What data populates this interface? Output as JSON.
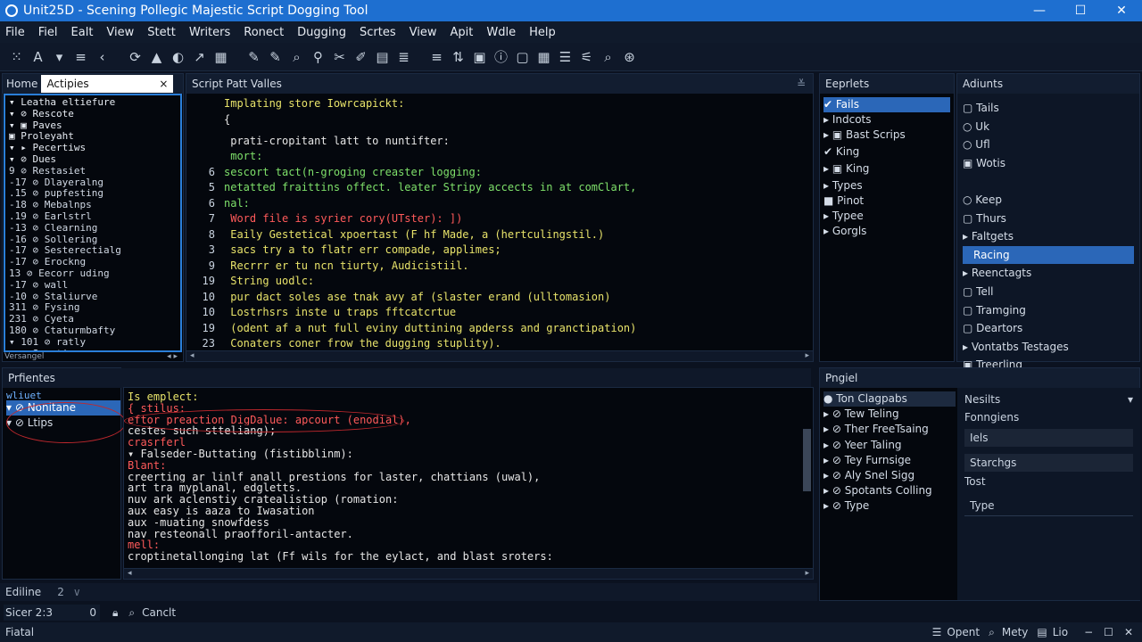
{
  "window": {
    "title": "Unit25D - Scening Pollegic Majestic Script Dogging Tool",
    "controls": [
      "—",
      "☐",
      "✕"
    ]
  },
  "menu": [
    "File",
    "Fiel",
    "Ealt",
    "View",
    "Stett",
    "Writers",
    "Ronect",
    "Dugging",
    "Scrtes",
    "View",
    "Apit",
    "Wdle",
    "Help"
  ],
  "toolbar": [
    "⁙",
    "A",
    "▾",
    "≡",
    "‹",
    "⟳",
    "▲",
    "◐",
    "↗",
    "▦",
    "✎",
    "✎",
    "⌕",
    "⚲",
    "✂",
    "✐",
    "▤",
    "≣",
    "≡",
    "⇅",
    "▣",
    "ⓘ",
    "▢",
    "▦",
    "☰",
    "⚟",
    "⌕",
    "⊛"
  ],
  "left_panel": {
    "tab1": "Home",
    "tab2": "Actipies",
    "footer": "Versangel",
    "tree": [
      "▾ Leatha eltiefure",
      "  ▾ ⊘ Rescote",
      "    ▾ ▣ Paves",
      "      ▣ Proleyaht",
      "    ▾ ▸ Pecertiws",
      "        ▾ ⊘ Dues",
      "     9    ⊘ Restasiet",
      "    -17     ⊘ Dlayeralng",
      "    .15     ⊘ pupfesting",
      "    -18     ⊘ Mebalnps",
      "    .19     ⊘ Earlstrl",
      "    -13     ⊘ Clearning",
      "    -16     ⊘ Sollering",
      "    -17     ⊘ Sesterectialg",
      "    -17     ⊘ Erockng",
      "     13     ⊘ Eecorr uding",
      "    -17     ⊘ wall",
      "    -10     ⊘ Staliurve",
      "     311    ⊘ Fysing",
      "     231    ⊘ Cyeta",
      "     180    ⊘ Ctaturmbafty",
      "    ▾ 101     ⊘ ratly",
      "  ▾ ⊘ Seerting"
    ]
  },
  "script_panel": {
    "title": "Script Patt Valles",
    "lines": [
      {
        "n": "",
        "t": "Implating store Iowrcapickt:",
        "c": "y"
      },
      {
        "n": "",
        "t": "{",
        "c": "w"
      },
      {
        "n": "",
        "t": "    prati-cropitant latt to nuntifter:",
        "c": "w"
      },
      {
        "n": "",
        "t": "    mort:",
        "c": "g"
      },
      {
        "n": "6",
        "t": "sescort tact(n-groging creaster logging:",
        "c": "g"
      },
      {
        "n": "5",
        "t": "netatted fraittins offect. leater Stripy accects in at comClart,",
        "c": "g"
      },
      {
        "n": "6",
        "t": "nal:",
        "c": "g"
      },
      {
        "n": "7",
        "t": "  Word file is syrier cory(UTster): ])",
        "c": "r"
      },
      {
        "n": "8",
        "t": "  Eaily Gestetical xpoertast (F hf Made, a (hertculingstil.)",
        "c": "y"
      },
      {
        "n": "3",
        "t": "  sacs try a to flatr err compade, applimes;",
        "c": "y"
      },
      {
        "n": "9",
        "t": "  Recrrr er tu ncn tiurty, Audicistiil.",
        "c": "y"
      },
      {
        "n": "19",
        "t": "  String uodlc:",
        "c": "y"
      },
      {
        "n": "10",
        "t": "  pur dact soles ase tnak avy af (slaster erand (ulltomasion)",
        "c": "y"
      },
      {
        "n": "10",
        "t": "  Lostrhsrs inste u traps fftcatcrtue",
        "c": "y"
      },
      {
        "n": "19",
        "t": "  (odent af a nut full eviny duttining apderss and granctipation)",
        "c": "y"
      },
      {
        "n": "23",
        "t": "  Conaters coner frow the dugging stuplity).",
        "c": "y"
      }
    ]
  },
  "explorer": {
    "title": "Eeprlets",
    "items": [
      "✔ Fails",
      "▸ Indcots",
      "▸ ▣ Bast Scrips",
      "    ✔ King",
      "    ▸ ▣ King",
      "  ▸ Types",
      "    ■ Pinot",
      "  ▸ Typee",
      "▸ Gorgls"
    ],
    "selected_index": 0
  },
  "adjust": {
    "title": "Adiunts",
    "items": [
      "▢ Tails",
      "○ Uk",
      "○ Ufl",
      "▣ Wotis",
      "",
      "○ Keep",
      "▢ Thurs",
      "▸ Faltgets",
      "Racing",
      "▸ Reenctagts",
      "▢ Tell",
      "▢ Tramging",
      "▢ Deartors",
      "▸ Vontatbs Testages",
      "▣ Treerling"
    ],
    "selected": "Racing"
  },
  "bottom_left": {
    "title": "Prfientes",
    "tree": [
      "▾ ⊘ Nonitane",
      "  ▾ ⊘ Ltips"
    ],
    "header": "wliuet"
  },
  "console": {
    "lines": [
      {
        "t": "Is emplect:",
        "c": "y"
      },
      {
        "t": "{   stilus:",
        "c": "r"
      },
      {
        "t": "eftor preaction DigDalue: apcourt (enodial),",
        "c": "r"
      },
      {
        "t": "cestes such stteliang);",
        "c": "w"
      },
      {
        "t": "crasrferl",
        "c": "r"
      },
      {
        "t": "    ▾ Falseder-Buttating (fistibblinm):",
        "c": "w"
      },
      {
        "t": "        Blant:",
        "c": "r"
      },
      {
        "t": "          creerting ar linlf anall prestions for laster, chattians (uwal),",
        "c": "w"
      },
      {
        "t": "          art tra myplanal, edgletts.",
        "c": "w"
      },
      {
        "t": "          nuv ark aclenstiy cratealistiop (romation:",
        "c": "w"
      },
      {
        "t": "          aux easy is aaza to Iwasation",
        "c": "w"
      },
      {
        "t": "          aux -muating snowfdess",
        "c": "w"
      },
      {
        "t": "          nav resteonall praofforil-antacter.",
        "c": "w"
      },
      {
        "t": "          mell:",
        "c": "r"
      },
      {
        "t": "          croptinetallonging lat (Ff wils for the eylact, and blast sroters:",
        "c": "w"
      }
    ]
  },
  "props": {
    "title": "Pngiel",
    "items": [
      "● Ton Clagpabs",
      "▸ ⊘ Tew Teling",
      "▸ ⊘ Ther FreeTsaing",
      "▸ ⊘ Yeer Taling",
      "▸ ⊘ Tey Furnsige",
      "▸ ⊘ Aly Snel Sigg",
      "▸ ⊘ Spotants Colling",
      "▸ ⊘ Type"
    ],
    "right": {
      "h1": "Nesilts",
      "h2": "Fonngiens",
      "f1": "Iels",
      "h3": "Starchgs",
      "f2": "Tost",
      "f3": "Type"
    }
  },
  "editline": {
    "label": "Ediline",
    "value": "2"
  },
  "findbar": {
    "field": "Sicer 2:3",
    "count": "0",
    "cancel": "Canclt"
  },
  "status": {
    "left": "Fiatal",
    "r1": "Opent",
    "r2": "Mety",
    "r3": "Lio"
  }
}
